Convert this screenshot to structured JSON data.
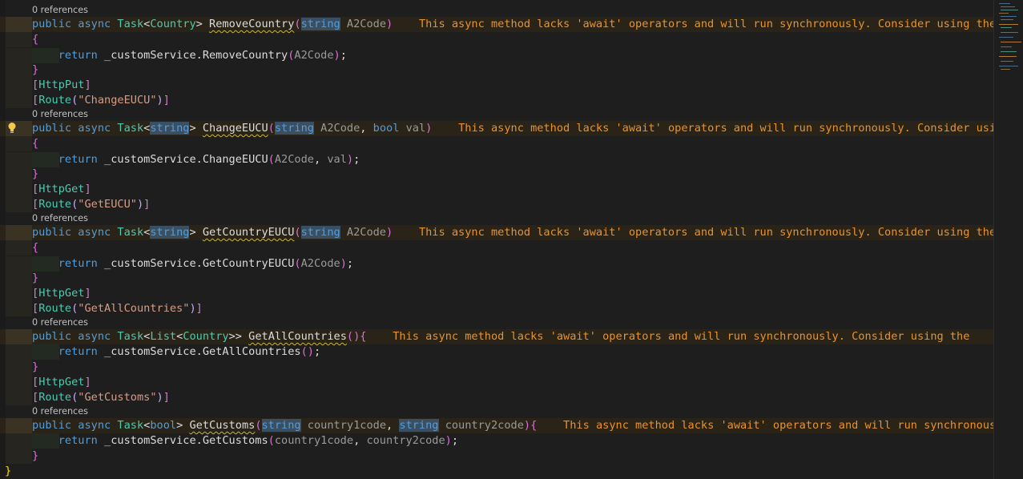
{
  "codelens": {
    "references": "0 references"
  },
  "tokens": {
    "public": "public",
    "async": "async",
    "task": "Task",
    "string": "string",
    "bool": "bool",
    "list": "List",
    "country": "Country",
    "return": "return",
    "service": "_customService.",
    "param_a2code": "A2Code",
    "param_val": "val",
    "param_c1": "country1code",
    "param_c2": "country2code",
    "http_put": "HttpPut",
    "http_get": "HttpGet",
    "route": "Route"
  },
  "methods": {
    "remove_country": "RemoveCountry",
    "change_eucu": "ChangeEUCU",
    "get_country_eucu": "GetCountryEUCU",
    "get_all_countries": "GetAllCountries",
    "get_customs": "GetCustoms"
  },
  "routes": {
    "change_eucu": "\"ChangeEUCU\"",
    "get_eucu": "\"GetEUCU\"",
    "get_all_countries": "\"GetAllCountries\"",
    "get_customs": "\"GetCustoms\""
  },
  "warnings": {
    "w1": "This async method lacks 'await' operators and will run synchronously. Consider using the",
    "w2": "This async method lacks 'await' operators and will run synchronously. Consider using the",
    "w3": "This async method lacks 'await' operators and will run synchronously. Consider using the",
    "w4": "This async method lacks 'await' operators and will run synchronously. Consider using the",
    "w5": "This async method lacks 'await' operators and will run synchronously. Consider using the"
  },
  "colors": {
    "background": "#1e1e1e",
    "keyword": "#569cd6",
    "type": "#4ec9b0",
    "warning_text": "#e8932e",
    "string": "#d69d85",
    "squiggle": "#c8b73c"
  },
  "icons": {
    "bulb": "lightbulb-icon"
  }
}
